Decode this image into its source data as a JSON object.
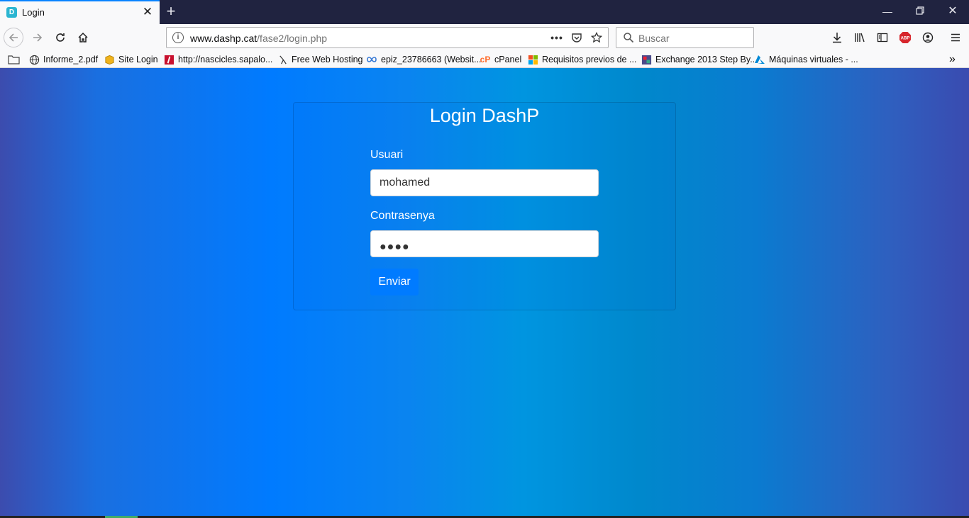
{
  "browser": {
    "tab": {
      "title": "Login",
      "favicon": "D"
    },
    "url": {
      "host": "www.dashp.cat",
      "path": "/fase2/login.php"
    },
    "search_placeholder": "Buscar",
    "bookmarks": [
      {
        "label": "Informe_2.pdf",
        "icon": "globe-icon"
      },
      {
        "label": "Site Login",
        "icon": "box-icon"
      },
      {
        "label": "http://nascicles.sapalo...",
        "icon": "red-page-icon"
      },
      {
        "label": "Free Web Hosting",
        "icon": "hosting-icon"
      },
      {
        "label": "epiz_23786663 (Websit...",
        "icon": "infinity-icon"
      },
      {
        "label": "cPanel",
        "icon": "cpanel-icon"
      },
      {
        "label": "Requisitos previos de ...",
        "icon": "microsoft-icon"
      },
      {
        "label": "Exchange 2013 Step By...",
        "icon": "exchange-icon"
      },
      {
        "label": "Máquinas virtuales - ...",
        "icon": "azure-icon"
      }
    ]
  },
  "login": {
    "title": "Login DashP",
    "user_label": "Usuari",
    "user_value": "mohamed",
    "password_label": "Contrasenya",
    "password_mask": "●●●●",
    "submit_label": "Enviar"
  },
  "colors": {
    "accent": "#007bff",
    "tab_accent": "#0a84ff",
    "titlebar": "#202340"
  }
}
